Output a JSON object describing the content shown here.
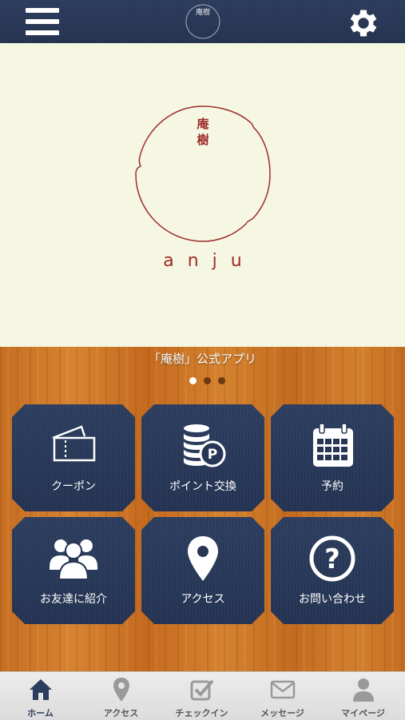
{
  "header": {
    "logo_text": "庵樹",
    "menu_icon": "hamburger-menu-icon",
    "settings_icon": "gear-icon",
    "color": "#24324f"
  },
  "hero": {
    "logo_chars": [
      "庵",
      "樹"
    ],
    "brand": "anju",
    "logo_color": "#9e2b2b",
    "background": "#f6f7e2"
  },
  "main": {
    "app_title": "「庵樹」公式アプリ",
    "carousel": {
      "pages": 3,
      "active": 1
    },
    "tiles": [
      {
        "label": "クーポン",
        "icon": "coupon-ticket-icon"
      },
      {
        "label": "ポイント交換",
        "icon": "point-coins-icon"
      },
      {
        "label": "予約",
        "icon": "calendar-icon"
      },
      {
        "label": "お友達に紹介",
        "icon": "friends-group-icon"
      },
      {
        "label": "アクセス",
        "icon": "map-pin-icon"
      },
      {
        "label": "お問い合わせ",
        "icon": "question-icon"
      }
    ]
  },
  "tabbar": {
    "active_color": "#2c3d5e",
    "inactive_color": "#9a9a9a",
    "items": [
      {
        "label": "ホーム",
        "icon": "home-icon",
        "active": true
      },
      {
        "label": "アクセス",
        "icon": "map-pin-icon",
        "active": false
      },
      {
        "label": "チェックイン",
        "icon": "checkin-icon",
        "active": false
      },
      {
        "label": "メッセージ",
        "icon": "envelope-icon",
        "active": false
      },
      {
        "label": "マイページ",
        "icon": "user-icon",
        "active": false
      }
    ]
  }
}
